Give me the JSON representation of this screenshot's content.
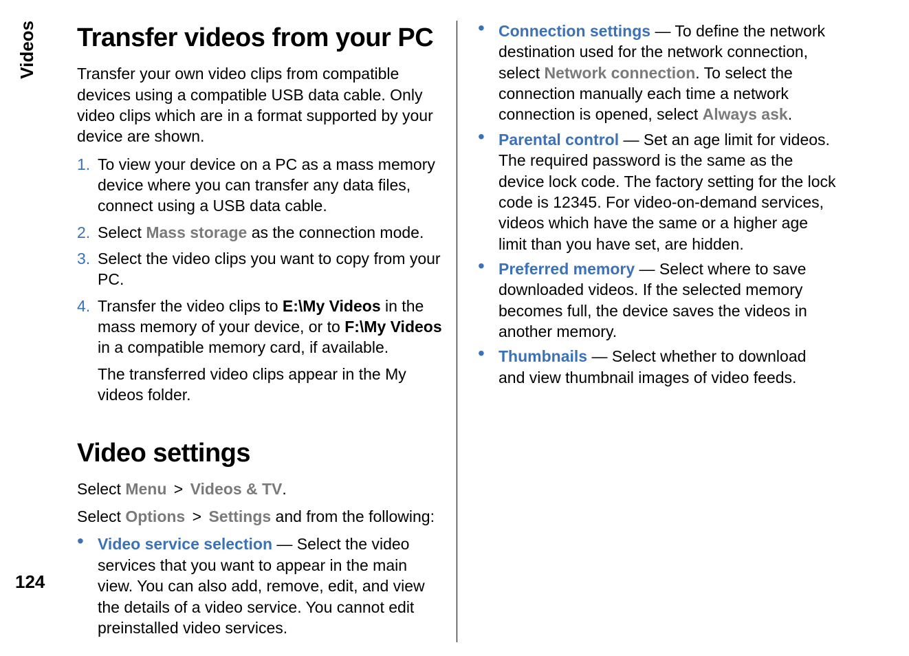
{
  "sidebar": {
    "label": "Videos",
    "page_number": "124"
  },
  "left": {
    "heading1": "Transfer videos from your PC",
    "intro": "Transfer your own video clips from compatible devices using a compatible USB data cable. Only video clips which are in a format supported by your device are shown.",
    "steps": [
      {
        "num": "1.",
        "text": "To view your device on a PC as a mass memory device where you can transfer any data files, connect using a USB data cable."
      },
      {
        "num": "2.",
        "pre": "Select ",
        "ui": "Mass storage",
        "post": " as the connection mode."
      },
      {
        "num": "3.",
        "text": "Select the video clips you want to copy from your PC."
      },
      {
        "num": "4.",
        "pre": "Transfer the video clips to ",
        "bold1": "E:\\My Videos",
        "mid": " in the mass memory of your device, or to ",
        "bold2": "F:\\My Videos",
        "post": " in a compatible memory card, if available.",
        "sub": "The transferred video clips appear in the My videos folder."
      }
    ],
    "heading2": "Video settings",
    "nav1": {
      "pre": "Select ",
      "a": "Menu",
      "sep": " > ",
      "b": "Videos & TV",
      "post": "."
    },
    "nav2": {
      "pre": "Select ",
      "a": "Options",
      "sep": " > ",
      "b": "Settings",
      "post": " and from the following:"
    },
    "settings_bullets": [
      {
        "label": "Video service selection",
        "text": "  — Select the video services that you want to appear in the main view. You can also add, remove, edit, and view the details of a video service. You cannot edit preinstalled video services."
      }
    ]
  },
  "right": {
    "bullets": [
      {
        "label": "Connection settings",
        "pre": "  — To define the network destination used for the network connection, select ",
        "ui1": "Network connection",
        "mid": ". To select the connection manually each time a network connection is opened, select ",
        "ui2": "Always ask",
        "post": "."
      },
      {
        "label": "Parental control",
        "text": "  — Set an age limit for videos. The required password is the same as the device lock code. The factory setting for the lock code is 12345. For video-on-demand services, videos which have the same or a higher age limit than you have set, are hidden."
      },
      {
        "label": "Preferred memory",
        "text": "  — Select where to save downloaded videos. If the selected memory becomes full, the device saves the videos in another memory."
      },
      {
        "label": "Thumbnails",
        "text": "  — Select whether to download and view thumbnail images of video feeds."
      }
    ]
  }
}
